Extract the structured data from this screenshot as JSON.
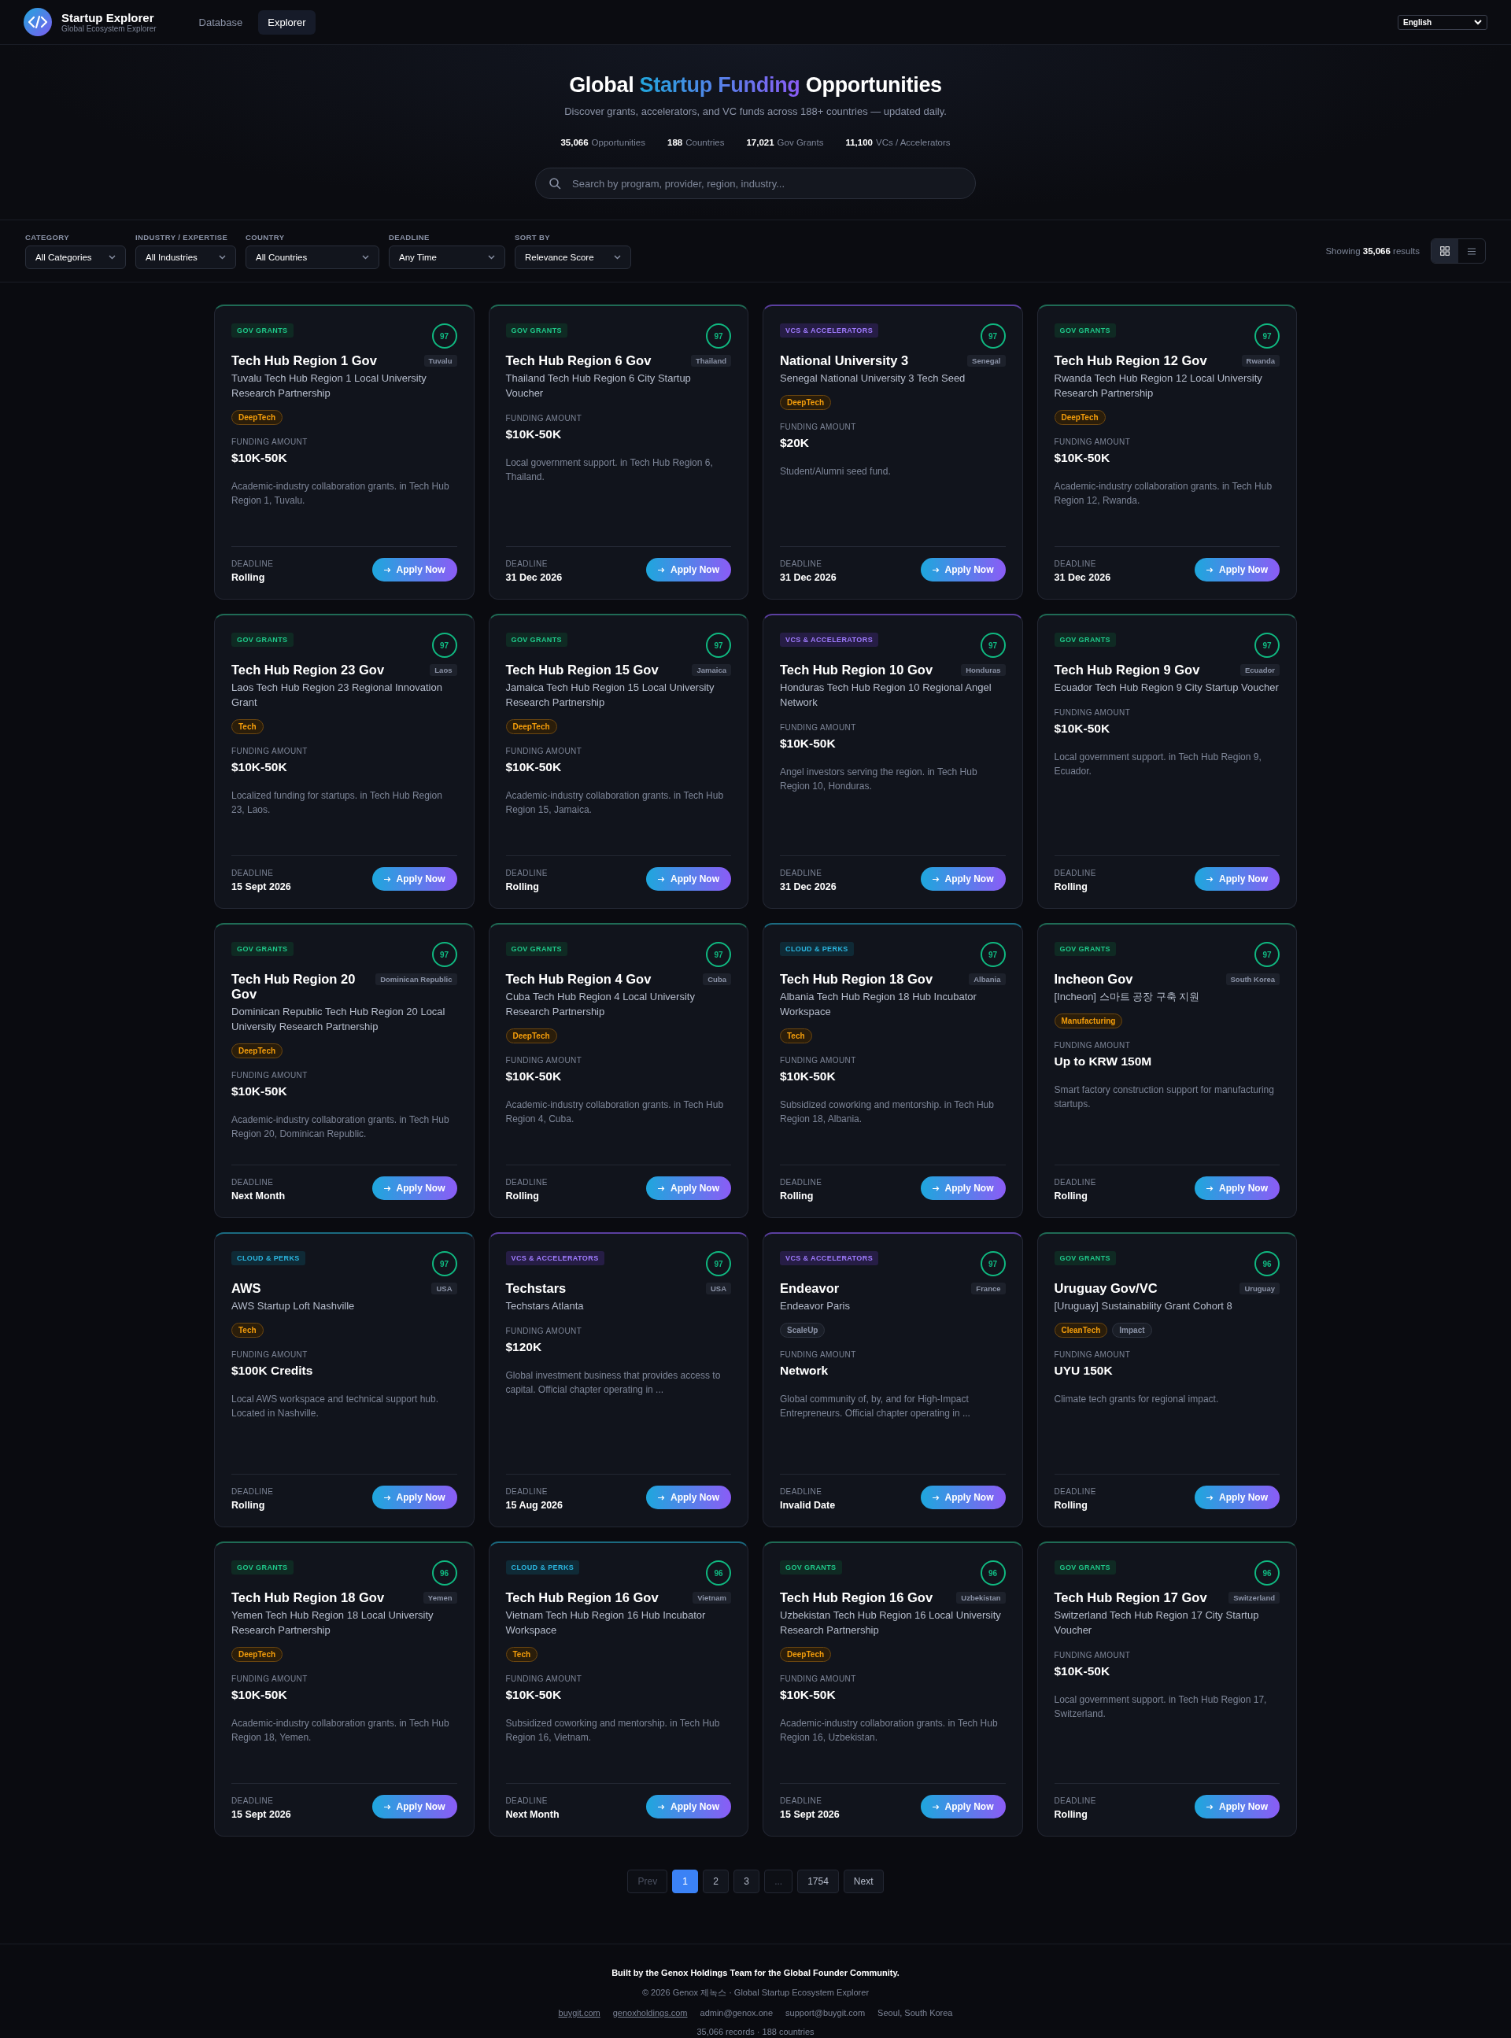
{
  "header": {
    "brand": "Startup Explorer",
    "tagline": "Global Ecosystem Explorer",
    "nav": [
      {
        "label": "Database",
        "selected": false
      },
      {
        "label": "Explorer",
        "selected": true
      }
    ],
    "language": "English"
  },
  "hero": {
    "title_parts": [
      {
        "text": "Global ",
        "highlight": false
      },
      {
        "text": "Startup Funding",
        "highlight": true
      },
      {
        "text": " Opportunities",
        "highlight": false
      }
    ],
    "subtitle": "Discover grants, accelerators, and VC funds across 188+ countries — updated daily.",
    "stats": [
      {
        "value": "35,066",
        "label": "Opportunities"
      },
      {
        "value": "188",
        "label": "Countries"
      },
      {
        "value": "17,021",
        "label": "Gov Grants"
      },
      {
        "value": "11,100",
        "label": "VCs / Accelerators"
      }
    ],
    "search": {
      "placeholder": "Search by program, provider, region, industry..."
    }
  },
  "filters": [
    {
      "label": "CATEGORY",
      "value": "All Categories"
    },
    {
      "label": "INDUSTRY / EXPERTISE",
      "value": "All Industries"
    },
    {
      "label": "COUNTRY",
      "value": "All Countries"
    },
    {
      "label": "DEADLINE",
      "value": "Any Time"
    },
    {
      "label": "SORT BY",
      "value": "Relevance Score"
    }
  ],
  "results": {
    "prefix": "Showing",
    "count": "35,066",
    "suffix": "results"
  },
  "views": [
    {
      "kind": "grid",
      "selected": true
    },
    {
      "kind": "list",
      "selected": false
    }
  ],
  "cards": [
    {
      "kind": "gov",
      "category": "GOV GRANTS",
      "score": "97",
      "name": "Tech Hub Region 1 Gov",
      "country": "Tuvalu",
      "program": "Tuvalu Tech Hub Region 1 Local University Research Partnership",
      "tags": [
        {
          "text": "DeepTech",
          "kind": "industry"
        }
      ],
      "funding_label": "FUNDING AMOUNT",
      "funding": "$10K-50K",
      "summary": "Academic-industry collaboration grants. in Tech Hub Region 1, Tuvalu.",
      "deadline_label": "DEADLINE",
      "deadline": "Rolling",
      "apply": "Apply Now"
    },
    {
      "kind": "gov",
      "category": "GOV GRANTS",
      "score": "97",
      "name": "Tech Hub Region 6 Gov",
      "country": "Thailand",
      "program": "Thailand Tech Hub Region 6 City Startup Voucher",
      "funding_label": "FUNDING AMOUNT",
      "funding": "$10K-50K",
      "summary": "Local government support. in Tech Hub Region 6, Thailand.",
      "deadline_label": "DEADLINE",
      "deadline": "31 Dec 2026",
      "apply": "Apply Now"
    },
    {
      "kind": "vc",
      "category": "VCS & ACCELERATORS",
      "score": "97",
      "name": "National University 3",
      "country": "Senegal",
      "program": "Senegal National University 3 Tech Seed",
      "tags": [
        {
          "text": "DeepTech",
          "kind": "industry"
        }
      ],
      "funding_label": "FUNDING AMOUNT",
      "funding": "$20K",
      "summary": "Student/Alumni seed fund.",
      "deadline_label": "DEADLINE",
      "deadline": "31 Dec 2026",
      "apply": "Apply Now"
    },
    {
      "kind": "gov",
      "category": "GOV GRANTS",
      "score": "97",
      "name": "Tech Hub Region 12 Gov",
      "country": "Rwanda",
      "program": "Rwanda Tech Hub Region 12 Local University Research Partnership",
      "tags": [
        {
          "text": "DeepTech",
          "kind": "industry"
        }
      ],
      "funding_label": "FUNDING AMOUNT",
      "funding": "$10K-50K",
      "summary": "Academic-industry collaboration grants. in Tech Hub Region 12, Rwanda.",
      "deadline_label": "DEADLINE",
      "deadline": "31 Dec 2026",
      "apply": "Apply Now"
    },
    {
      "kind": "gov",
      "category": "GOV GRANTS",
      "score": "97",
      "name": "Tech Hub Region 23 Gov",
      "country": "Laos",
      "program": "Laos Tech Hub Region 23 Regional Innovation Grant",
      "tags": [
        {
          "text": "Tech",
          "kind": "industry"
        }
      ],
      "funding_label": "FUNDING AMOUNT",
      "funding": "$10K-50K",
      "summary": "Localized funding for startups. in Tech Hub Region 23, Laos.",
      "deadline_label": "DEADLINE",
      "deadline": "15 Sept 2026",
      "apply": "Apply Now"
    },
    {
      "kind": "gov",
      "category": "GOV GRANTS",
      "score": "97",
      "name": "Tech Hub Region 15 Gov",
      "country": "Jamaica",
      "program": "Jamaica Tech Hub Region 15 Local University Research Partnership",
      "tags": [
        {
          "text": "DeepTech",
          "kind": "industry"
        }
      ],
      "funding_label": "FUNDING AMOUNT",
      "funding": "$10K-50K",
      "summary": "Academic-industry collaboration grants. in Tech Hub Region 15, Jamaica.",
      "deadline_label": "DEADLINE",
      "deadline": "Rolling",
      "apply": "Apply Now"
    },
    {
      "kind": "vc",
      "category": "VCS & ACCELERATORS",
      "score": "97",
      "name": "Tech Hub Region 10 Gov",
      "country": "Honduras",
      "program": "Honduras Tech Hub Region 10 Regional Angel Network",
      "funding_label": "FUNDING AMOUNT",
      "funding": "$10K-50K",
      "summary": "Angel investors serving the region. in Tech Hub Region 10, Honduras.",
      "deadline_label": "DEADLINE",
      "deadline": "31 Dec 2026",
      "apply": "Apply Now"
    },
    {
      "kind": "gov",
      "category": "GOV GRANTS",
      "score": "97",
      "name": "Tech Hub Region 9 Gov",
      "country": "Ecuador",
      "program": "Ecuador Tech Hub Region 9 City Startup Voucher",
      "funding_label": "FUNDING AMOUNT",
      "funding": "$10K-50K",
      "summary": "Local government support. in Tech Hub Region 9, Ecuador.",
      "deadline_label": "DEADLINE",
      "deadline": "Rolling",
      "apply": "Apply Now"
    },
    {
      "kind": "gov",
      "category": "GOV GRANTS",
      "score": "97",
      "name": "Tech Hub Region 20 Gov",
      "country": "Dominican Republic",
      "program": "Dominican Republic Tech Hub Region 20 Local University Research Partnership",
      "tags": [
        {
          "text": "DeepTech",
          "kind": "industry"
        }
      ],
      "funding_label": "FUNDING AMOUNT",
      "funding": "$10K-50K",
      "summary": "Academic-industry collaboration grants. in Tech Hub Region 20, Dominican Republic.",
      "deadline_label": "DEADLINE",
      "deadline": "Next Month",
      "apply": "Apply Now"
    },
    {
      "kind": "gov",
      "category": "GOV GRANTS",
      "score": "97",
      "name": "Tech Hub Region 4 Gov",
      "country": "Cuba",
      "program": "Cuba Tech Hub Region 4 Local University Research Partnership",
      "tags": [
        {
          "text": "DeepTech",
          "kind": "industry"
        }
      ],
      "funding_label": "FUNDING AMOUNT",
      "funding": "$10K-50K",
      "summary": "Academic-industry collaboration grants. in Tech Hub Region 4, Cuba.",
      "deadline_label": "DEADLINE",
      "deadline": "Rolling",
      "apply": "Apply Now"
    },
    {
      "kind": "cloud",
      "category": "CLOUD & PERKS",
      "score": "97",
      "name": "Tech Hub Region 18 Gov",
      "country": "Albania",
      "program": "Albania Tech Hub Region 18 Hub Incubator Workspace",
      "tags": [
        {
          "text": "Tech",
          "kind": "industry"
        }
      ],
      "funding_label": "FUNDING AMOUNT",
      "funding": "$10K-50K",
      "summary": "Subsidized coworking and mentorship. in Tech Hub Region 18, Albania.",
      "deadline_label": "DEADLINE",
      "deadline": "Rolling",
      "apply": "Apply Now"
    },
    {
      "kind": "gov",
      "category": "GOV GRANTS",
      "score": "97",
      "name": "Incheon Gov",
      "country": "South Korea",
      "program": "[Incheon] 스마트 공장 구축 지원",
      "tags": [
        {
          "text": "Manufacturing",
          "kind": "industry"
        }
      ],
      "funding_label": "FUNDING AMOUNT",
      "funding": "Up to KRW 150M",
      "summary": "Smart factory construction support for manufacturing startups.",
      "deadline_label": "DEADLINE",
      "deadline": "Rolling",
      "apply": "Apply Now"
    },
    {
      "kind": "cloud",
      "category": "CLOUD & PERKS",
      "score": "97",
      "name": "AWS",
      "country": "USA",
      "program": "AWS Startup Loft Nashville",
      "tags": [
        {
          "text": "Tech",
          "kind": "industry"
        }
      ],
      "funding_label": "FUNDING AMOUNT",
      "funding": "$100K Credits",
      "summary": "Local AWS workspace and technical support hub. Located in Nashville.",
      "deadline_label": "DEADLINE",
      "deadline": "Rolling",
      "apply": "Apply Now"
    },
    {
      "kind": "vc",
      "category": "VCS & ACCELERATORS",
      "score": "97",
      "name": "Techstars",
      "country": "USA",
      "program": "Techstars Atlanta",
      "funding_label": "FUNDING AMOUNT",
      "funding": "$120K",
      "summary": "Global investment business that provides access to capital. Official chapter operating in ...",
      "deadline_label": "DEADLINE",
      "deadline": "15 Aug 2026",
      "apply": "Apply Now"
    },
    {
      "kind": "vc",
      "category": "VCS & ACCELERATORS",
      "score": "97",
      "name": "Endeavor",
      "country": "France",
      "program": "Endeavor Paris",
      "tags": [
        {
          "text": "ScaleUp",
          "kind": "plain"
        }
      ],
      "funding_label": "FUNDING AMOUNT",
      "funding": "Network",
      "summary": "Global community of, by, and for High-Impact Entrepreneurs. Official chapter operating in ...",
      "deadline_label": "DEADLINE",
      "deadline": "Invalid Date",
      "apply": "Apply Now"
    },
    {
      "kind": "gov",
      "category": "GOV GRANTS",
      "score": "96",
      "name": "Uruguay Gov/VC",
      "country": "Uruguay",
      "program": "[Uruguay] Sustainability Grant Cohort 8",
      "tags": [
        {
          "text": "CleanTech",
          "kind": "industry"
        },
        {
          "text": "Impact",
          "kind": "plain"
        }
      ],
      "funding_label": "FUNDING AMOUNT",
      "funding": "UYU 150K",
      "summary": "Climate tech grants for regional impact.",
      "deadline_label": "DEADLINE",
      "deadline": "Rolling",
      "apply": "Apply Now"
    },
    {
      "kind": "gov",
      "category": "GOV GRANTS",
      "score": "96",
      "name": "Tech Hub Region 18 Gov",
      "country": "Yemen",
      "program": "Yemen Tech Hub Region 18 Local University Research Partnership",
      "tags": [
        {
          "text": "DeepTech",
          "kind": "industry"
        }
      ],
      "funding_label": "FUNDING AMOUNT",
      "funding": "$10K-50K",
      "summary": "Academic-industry collaboration grants. in Tech Hub Region 18, Yemen.",
      "deadline_label": "DEADLINE",
      "deadline": "15 Sept 2026",
      "apply": "Apply Now"
    },
    {
      "kind": "cloud",
      "category": "CLOUD & PERKS",
      "score": "96",
      "name": "Tech Hub Region 16 Gov",
      "country": "Vietnam",
      "program": "Vietnam Tech Hub Region 16 Hub Incubator Workspace",
      "tags": [
        {
          "text": "Tech",
          "kind": "industry"
        }
      ],
      "funding_label": "FUNDING AMOUNT",
      "funding": "$10K-50K",
      "summary": "Subsidized coworking and mentorship. in Tech Hub Region 16, Vietnam.",
      "deadline_label": "DEADLINE",
      "deadline": "Next Month",
      "apply": "Apply Now"
    },
    {
      "kind": "gov",
      "category": "GOV GRANTS",
      "score": "96",
      "name": "Tech Hub Region 16 Gov",
      "country": "Uzbekistan",
      "program": "Uzbekistan Tech Hub Region 16 Local University Research Partnership",
      "tags": [
        {
          "text": "DeepTech",
          "kind": "industry"
        }
      ],
      "funding_label": "FUNDING AMOUNT",
      "funding": "$10K-50K",
      "summary": "Academic-industry collaboration grants. in Tech Hub Region 16, Uzbekistan.",
      "deadline_label": "DEADLINE",
      "deadline": "15 Sept 2026",
      "apply": "Apply Now"
    },
    {
      "kind": "gov",
      "category": "GOV GRANTS",
      "score": "96",
      "name": "Tech Hub Region 17 Gov",
      "country": "Switzerland",
      "program": "Switzerland Tech Hub Region 17 City Startup Voucher",
      "funding_label": "FUNDING AMOUNT",
      "funding": "$10K-50K",
      "summary": "Local government support. in Tech Hub Region 17, Switzerland.",
      "deadline_label": "DEADLINE",
      "deadline": "Rolling",
      "apply": "Apply Now"
    }
  ],
  "pagination": [
    {
      "label": "Prev",
      "selected": false,
      "disabled": true
    },
    {
      "label": "1",
      "selected": true,
      "disabled": false
    },
    {
      "label": "2",
      "selected": false,
      "disabled": false
    },
    {
      "label": "3",
      "selected": false,
      "disabled": false
    },
    {
      "label": "...",
      "selected": false,
      "disabled": true
    },
    {
      "label": "1754",
      "selected": false,
      "disabled": false
    },
    {
      "label": "Next",
      "selected": false,
      "disabled": false
    }
  ],
  "footer": {
    "credit": "Built by the Genox Holdings Team for the Global Founder Community.",
    "copyright": "© 2026 Genox 제녹스 · Global Startup Ecosystem Explorer",
    "contacts": [
      {
        "text": "buygit.com",
        "kind": "link"
      },
      {
        "text": "genoxholdings.com",
        "kind": "link"
      },
      {
        "text": "admin@genox.one",
        "kind": "text"
      },
      {
        "text": "support@buygit.com",
        "kind": "text"
      },
      {
        "text": "Seoul, South Korea",
        "kind": "text"
      }
    ],
    "records": "35,066 records · 188 countries"
  }
}
